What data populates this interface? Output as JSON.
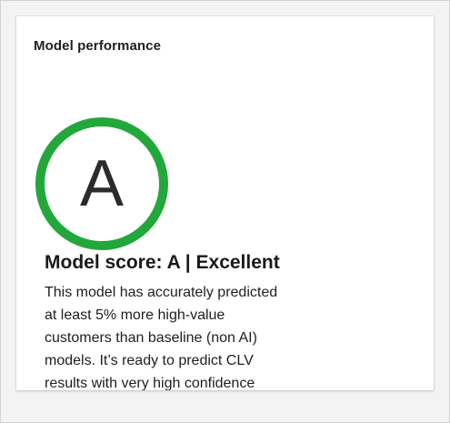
{
  "card": {
    "title": "Model performance"
  },
  "score": {
    "grade": "A",
    "ring_color": "#22a83a",
    "heading": "Model score: A | Excellent",
    "description": "This model has accurately predicted at least 5% more high-value customers than baseline (non AI) models. It’s ready to predict CLV results with very high confidence"
  }
}
